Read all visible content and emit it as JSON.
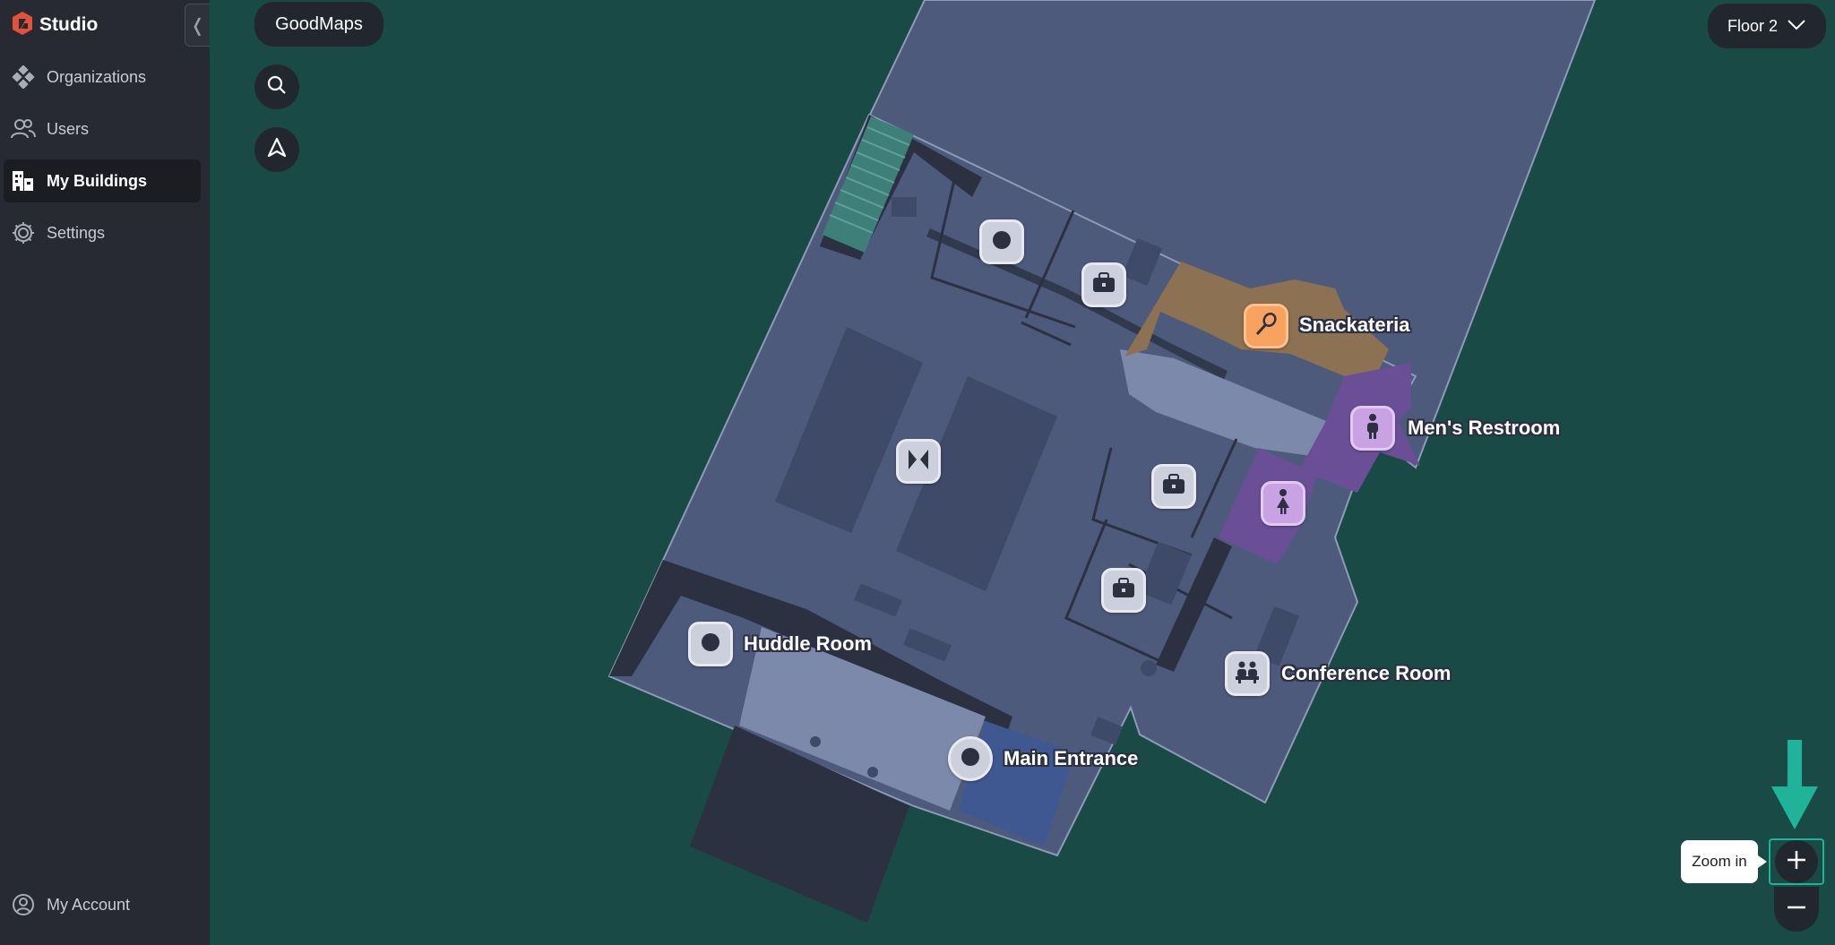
{
  "sidebar": {
    "brand": "Studio",
    "collapse_label": "❬",
    "items": [
      {
        "label": "Organizations",
        "icon": "organizations-icon"
      },
      {
        "label": "Users",
        "icon": "users-icon"
      },
      {
        "label": "My Buildings",
        "icon": "buildings-icon",
        "active": true
      },
      {
        "label": "Settings",
        "icon": "gear-icon"
      }
    ],
    "account_label": "My Account"
  },
  "map": {
    "title": "GoodMaps",
    "floor_selector": "Floor 2",
    "labels": {
      "snackateria": "Snackateria",
      "mens_restroom": "Men's Restroom",
      "huddle_room": "Huddle Room",
      "conference_room": "Conference Room",
      "main_entrance": "Main Entrance"
    },
    "zoom_tooltip": "Zoom in"
  },
  "colors": {
    "background": "#1a4a45",
    "sidebar": "#272a33",
    "floor": "#4e5a7c",
    "accent": "#1fb39a",
    "food": "#8c7252",
    "restroom": "#6a4f97"
  }
}
